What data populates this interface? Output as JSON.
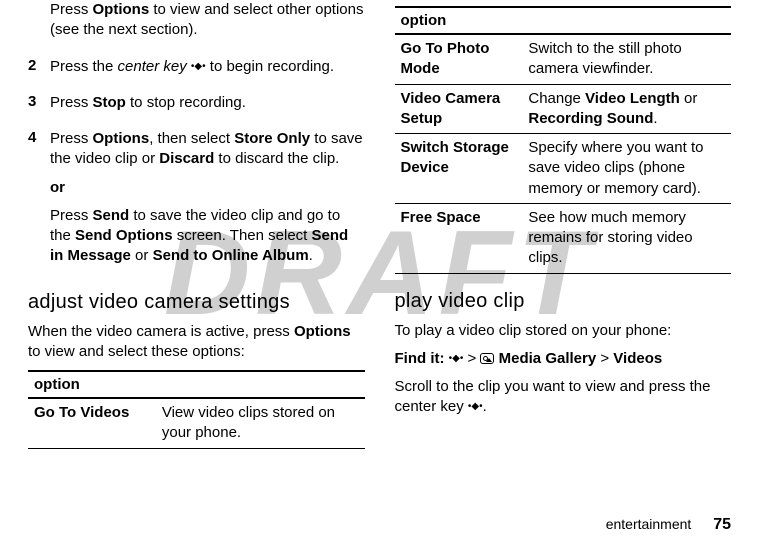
{
  "watermark": "DRAFT",
  "left": {
    "intro": {
      "press": "Press ",
      "options": "Options",
      "rest": " to view and select other options (see the next section)."
    },
    "step2": {
      "num": "2",
      "t1": "Press the ",
      "centerkey": "center key",
      "t2": " to begin recording."
    },
    "step3": {
      "num": "3",
      "t1": "Press ",
      "stop": "Stop",
      "t2": " to stop recording."
    },
    "step4": {
      "num": "4",
      "p1_a": "Press ",
      "p1_options": "Options",
      "p1_b": ", then select ",
      "p1_storeonly": "Store Only",
      "p1_c": " to save the video clip or ",
      "p1_discard": "Discard",
      "p1_d": " to discard the clip.",
      "or": "or",
      "p2_a": "Press ",
      "p2_send": "Send",
      "p2_b": " to save the video clip and go to the ",
      "p2_sendoptions": "Send Options",
      "p2_c": " screen. Then select ",
      "p2_sendinmessage": "Send in Message",
      "p2_d": " or ",
      "p2_sendtoonline": "Send to Online Album",
      "p2_e": "."
    },
    "heading": "adjust video camera settings",
    "desc_a": "When the video camera is active, press ",
    "desc_options": "Options",
    "desc_b": " to view and select these options:",
    "table": {
      "header": "option",
      "row1_label": "Go To Videos",
      "row1_desc": "View video clips stored on your phone."
    }
  },
  "right": {
    "table": {
      "header": "option",
      "row1_label": "Go To Photo Mode",
      "row1_desc": "Switch to the still photo camera viewfinder.",
      "row2_label": "Video Camera Setup",
      "row2_desc_a": "Change ",
      "row2_desc_b": "Video Length",
      "row2_desc_c": " or ",
      "row2_desc_d": "Recording Sound",
      "row2_desc_e": ".",
      "row3_label": "Switch Storage Device",
      "row3_desc": "Specify where you want to save video clips (phone memory or memory card).",
      "row4_label": "Free Space",
      "row4_desc": "See how much memory remains for storing video clips."
    },
    "heading": "play video clip",
    "desc": "To play a video clip stored on your phone:",
    "findit_label": "Find it:",
    "findit_gt1": " > ",
    "findit_mediagallery": "Media Gallery",
    "findit_gt2": " > ",
    "findit_videos": "Videos",
    "scroll_a": "Scroll to the clip you want to view and press the center key ",
    "scroll_b": "."
  },
  "footer": {
    "section": "entertainment",
    "page": "75"
  }
}
